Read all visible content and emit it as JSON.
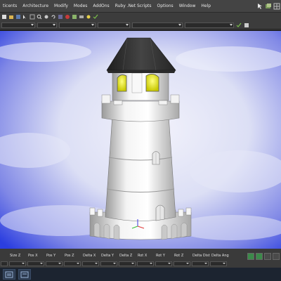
{
  "menu": {
    "items": [
      "ticents",
      "Architecture",
      "Modify",
      "Modes",
      "AddOns",
      "Ruby .Net Scripts",
      "Options",
      "Window",
      "Help"
    ]
  },
  "coordbar": {
    "labels": [
      "",
      "Size Z",
      "Pos X",
      "Pos Y",
      "Pos Z",
      "Delta X",
      "Delta Y",
      "Delta Z",
      "Rot X",
      "Rot Y",
      "Rot Z",
      "Delta Distanc",
      "Delta Angle",
      ""
    ]
  },
  "colors": {
    "viewport_bg": "#c6c8ef",
    "sky_blue": "#2b3ee0",
    "lighthouse_white": "#f2f2f2",
    "roof": "#3a3a3a",
    "window_glow": "#d8e000",
    "ui_dark": "#3a3a3a"
  },
  "icons": {
    "menubar": [
      "select-icon",
      "grid-icon",
      "zoom-icon",
      "pan-icon",
      "rotate-icon",
      "render-icon",
      "close-icon",
      "snap-icon",
      "layer-icon",
      "camera-icon"
    ],
    "status": [
      "view-icon",
      "render-mode-icon",
      "grid-toggle-icon",
      "settings-icon"
    ]
  }
}
